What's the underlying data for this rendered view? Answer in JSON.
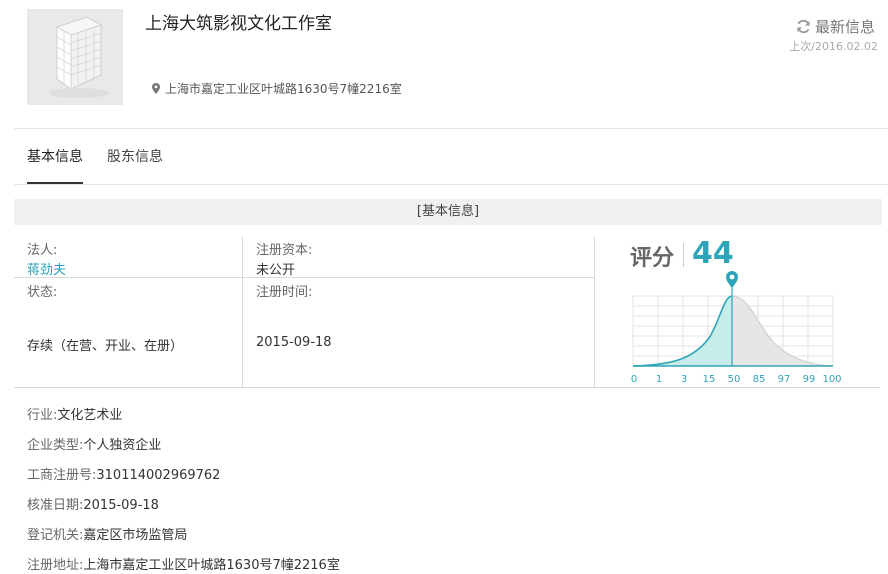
{
  "company": {
    "name": "上海大筑影视文化工作室",
    "address": "上海市嘉定工业区叶城路1630号7幢2216室"
  },
  "refresh": {
    "label": "最新信息",
    "last_update": "上次/2016.02.02"
  },
  "tabs": [
    {
      "label": "基本信息",
      "active": true
    },
    {
      "label": "股东信息",
      "active": false
    }
  ],
  "section_title": "[基本信息]",
  "basic": {
    "legal_person_label": "法人:",
    "legal_person_value": "蒋劲夫",
    "capital_label": "注册资本:",
    "capital_value": "未公开",
    "status_label": "状态:",
    "status_value": "存续（在营、开业、在册）",
    "reg_date_label": "注册时间:",
    "reg_date_value": "2015-09-18"
  },
  "score": {
    "label": "评分",
    "value": "44",
    "scale_ticks": [
      "0",
      "1",
      "3",
      "15",
      "50",
      "85",
      "97",
      "99",
      "100"
    ],
    "accent_color": "#2ea4b8"
  },
  "details": [
    {
      "key": "行业:",
      "value": "文化艺术业"
    },
    {
      "key": "企业类型:",
      "value": "个人独资企业"
    },
    {
      "key": "工商注册号:",
      "value": "310114002969762"
    },
    {
      "key": "核准日期:",
      "value": "2015-09-18"
    },
    {
      "key": "登记机关:",
      "value": "嘉定区市场监管局"
    },
    {
      "key": "注册地址:",
      "value": "上海市嘉定工业区叶城路1630号7幢2216室"
    }
  ],
  "icons": {
    "logo": "building-icon",
    "address": "location-pin-icon",
    "refresh": "refresh-icon",
    "marker": "map-marker-icon"
  }
}
